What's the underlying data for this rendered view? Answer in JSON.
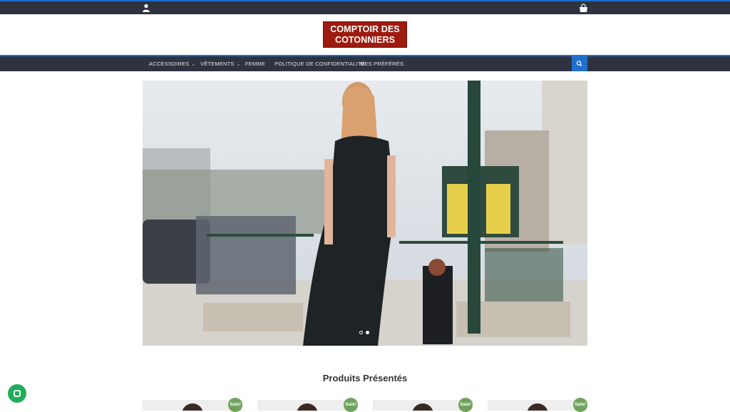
{
  "topbar": {
    "user_icon": "user-icon",
    "cart_icon": "shopping-bag-icon"
  },
  "logo": {
    "line1": "COMPTOIR DES",
    "line2": "COTONNIERS"
  },
  "nav": {
    "items": [
      {
        "label": "ACCESSOIRES",
        "has_dropdown": true
      },
      {
        "label": "VÊTEMENTS",
        "has_dropdown": true
      },
      {
        "label": "FEMME",
        "has_dropdown": false
      },
      {
        "label": "POLITIQUE DE CONFIDENTIALITÉ",
        "has_dropdown": false
      },
      {
        "label": "MES PRÉFÉRÉS",
        "has_dropdown": false
      }
    ],
    "search_icon": "search-icon",
    "accent": "#1f6fcf"
  },
  "hero": {
    "slide_count": 2,
    "active_slide": 2
  },
  "featured": {
    "title": "Produits Présentés",
    "products": [
      {
        "badge": "Sale!"
      },
      {
        "badge": "Sale!"
      },
      {
        "badge": "Sale!"
      },
      {
        "badge": "Sale!"
      }
    ]
  },
  "chat": {
    "icon": "chat-icon",
    "color": "#1fae5a"
  }
}
